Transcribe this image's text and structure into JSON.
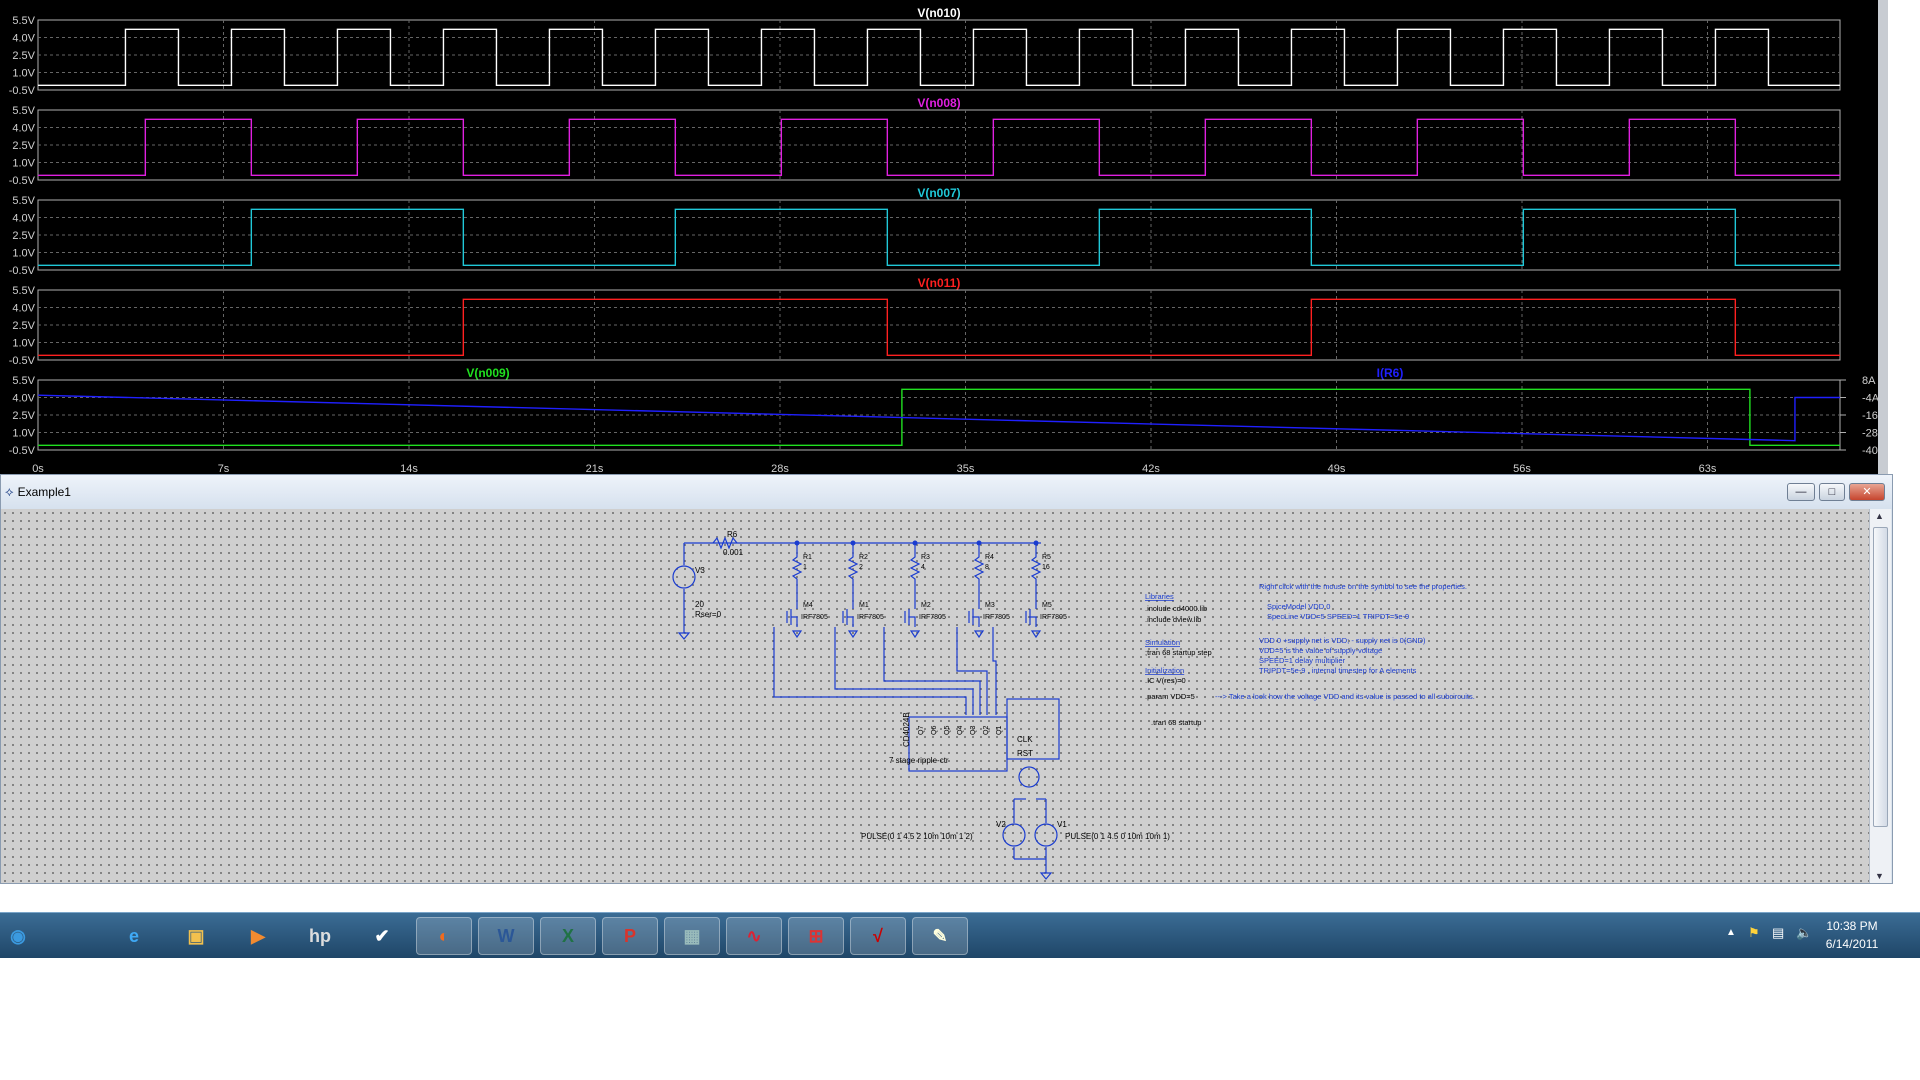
{
  "waveform": {
    "y_ticks": [
      "5.5V",
      "4.0V",
      "2.5V",
      "1.0V",
      "-0.5V"
    ],
    "x_ticks": [
      "0s",
      "7s",
      "14s",
      "21s",
      "28s",
      "35s",
      "42s",
      "49s",
      "56s",
      "63s"
    ],
    "right_ticks": [
      "8A",
      "-4A",
      "-16A",
      "-28A",
      "-40A"
    ],
    "panes": [
      {
        "label": "V(n010)",
        "color": "#ffffff"
      },
      {
        "label": "V(n008)",
        "color": "#e020e0"
      },
      {
        "label": "V(n007)",
        "color": "#20c8d8"
      },
      {
        "label": "V(n011)",
        "color": "#ff2020"
      },
      {
        "label": "V(n009)",
        "label2": "I(R6)",
        "color": "#20e020",
        "color2": "#2020ff"
      }
    ]
  },
  "schematic_window": {
    "title": "Example1",
    "buttons": {
      "minimize": "—",
      "maximize": "□",
      "close": "✕"
    },
    "resistors": [
      {
        "name": "R6",
        "value": "0.001"
      },
      {
        "name": "R1",
        "value": "1"
      },
      {
        "name": "R2",
        "value": "2"
      },
      {
        "name": "R3",
        "value": "4"
      },
      {
        "name": "R4",
        "value": "8"
      },
      {
        "name": "R5",
        "value": "16"
      }
    ],
    "mosfets": [
      {
        "name": "M4",
        "model": "IRF7805"
      },
      {
        "name": "M1",
        "model": "IRF7805"
      },
      {
        "name": "M2",
        "model": "IRF7805"
      },
      {
        "name": "M3",
        "model": "IRF7805"
      },
      {
        "name": "M5",
        "model": "IRF7805"
      }
    ],
    "source_v3": {
      "name": "V3",
      "value": "20",
      "rser": "Rser=0"
    },
    "counter": {
      "part": "CD4024B",
      "desc": "7 stage ripple-ctr",
      "pins": [
        "Q7",
        "Q6",
        "Q5",
        "Q4",
        "Q3",
        "Q2",
        "Q1"
      ],
      "clk": "CLK",
      "rst": "RST"
    },
    "sources": [
      {
        "name": "V2",
        "pulse": "PULSE(0 1 4.5 2 10m 10m 1 2)"
      },
      {
        "name": "V1",
        "pulse": "PULSE(0 1 4.5 0 10m 10m 1)"
      }
    ],
    "notes": {
      "libraries_hdr": "Libraries",
      "lib1": ".include cd4000.lib",
      "lib2": ".include dview.lib",
      "sim_hdr": "Simulation",
      "sim1": ";tran 68 startup step",
      "init_hdr": "Initialization",
      "init1": ".IC V(res)=0",
      "param": ".param VDD=5",
      "tran": ".tran 68 startup",
      "arrow_note": "---> Take a look how the voltage VDD and its value is passed to all subcircuits.",
      "right_click": "Right click with the mouse on the symbol to see the properties.",
      "spice_model": "SpiceModel   VDD 0",
      "spice_line": "SpecLine     VDD=5  SPEED=1 TRIPDT=5e-9",
      "vdd0": "VDD 0     +supply net is VDD; - supply net is 0(GND)",
      "vdd5": "VDD=5 is the value of supply-voltage",
      "speed": "SPEED=1   delay multiplier",
      "tripdt": "TRIPDT=5e-9 , internal timestep for A elements"
    }
  },
  "taskbar": {
    "time": "10:38 PM",
    "date": "6/14/2011",
    "apps": [
      "start",
      "ie",
      "explorer",
      "media",
      "hp",
      "tasks",
      "firefox",
      "word",
      "excel",
      "pdf",
      "calculator",
      "ltspice",
      "tool",
      "acrobat",
      "paint"
    ]
  }
}
